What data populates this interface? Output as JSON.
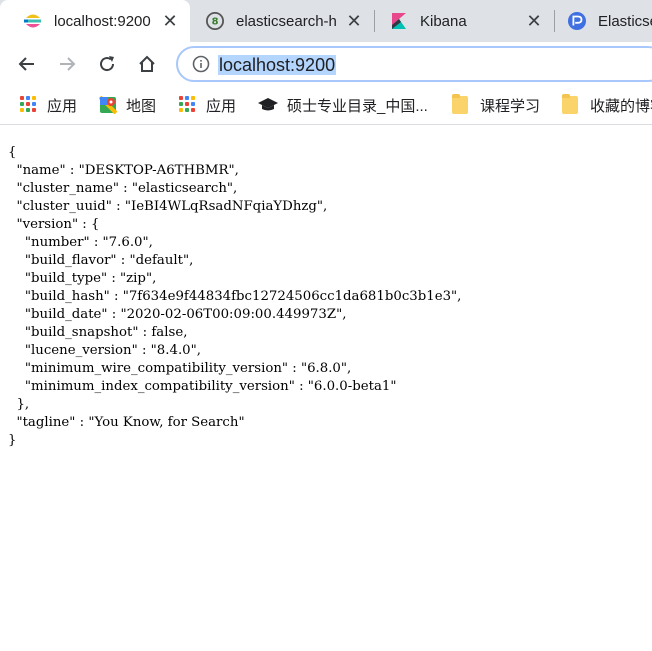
{
  "tabs": [
    {
      "title": "localhost:9200",
      "active": true,
      "icon": "elastic-logo-icon"
    },
    {
      "title": "elasticsearch-h",
      "active": false,
      "icon": "elasticsearch-head-icon"
    },
    {
      "title": "Kibana",
      "active": false,
      "icon": "kibana-icon"
    },
    {
      "title": "Elasticse",
      "active": false,
      "icon": "elastic-blue-icon"
    }
  ],
  "toolbar": {
    "url": "localhost:9200"
  },
  "bookmarks": [
    {
      "label": "应用",
      "icon": "apps-grid-icon"
    },
    {
      "label": "地图",
      "icon": "maps-icon"
    },
    {
      "label": "应用",
      "icon": "apps-grid-icon"
    },
    {
      "label": "硕士专业目录_中国...",
      "icon": "graduation-cap-icon"
    },
    {
      "label": "课程学习",
      "icon": "folder-icon"
    },
    {
      "label": "收藏的博客",
      "icon": "folder-icon"
    }
  ],
  "json_response": {
    "name": "DESKTOP-A6THBMR",
    "cluster_name": "elasticsearch",
    "cluster_uuid": "IeBI4WLqRsadNFqiaYDhzg",
    "version": {
      "number": "7.6.0",
      "build_flavor": "default",
      "build_type": "zip",
      "build_hash": "7f634e9f44834fbc12724506cc1da681b0c3b1e3",
      "build_date": "2020-02-06T00:09:00.449973Z",
      "build_snapshot": "false",
      "lucene_version": "8.4.0",
      "minimum_wire_compatibility_version": "6.8.0",
      "minimum_index_compatibility_version": "6.0.0-beta1"
    },
    "tagline": "You Know, for Search"
  }
}
